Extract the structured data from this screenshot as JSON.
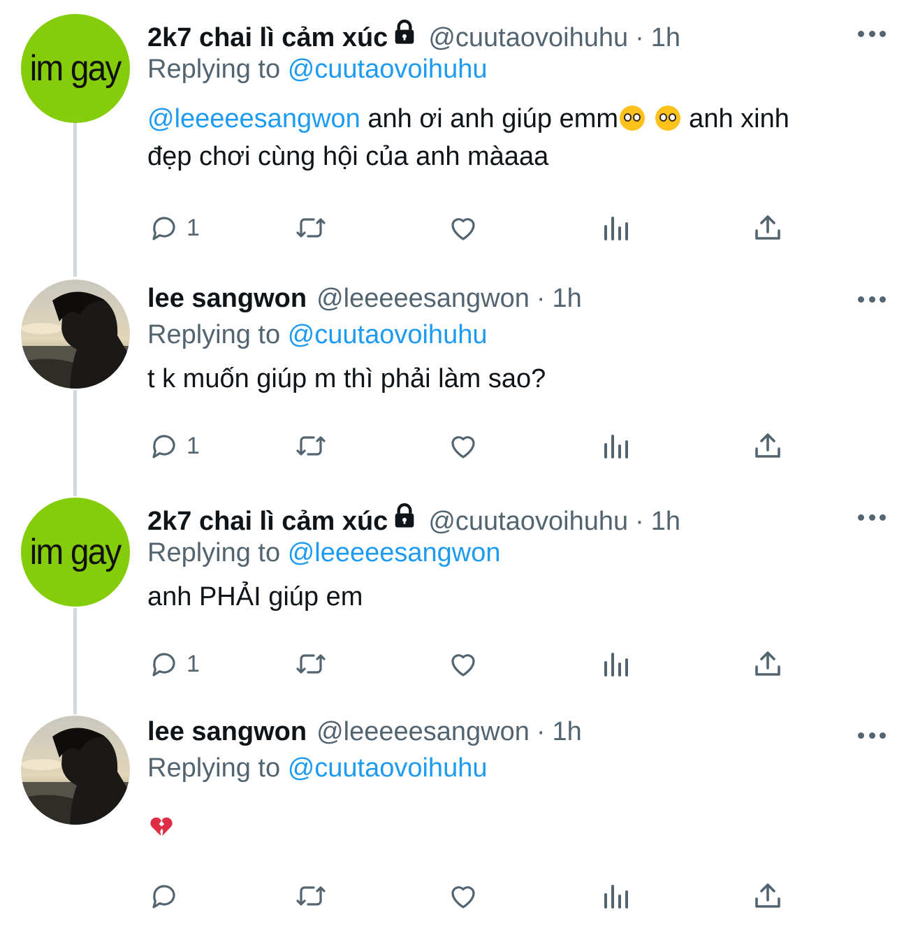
{
  "tweets": [
    {
      "avatar": "im-gay-avatar",
      "avatar_text": "im gay",
      "name": "2k7 chai lì cảm xúc",
      "locked": true,
      "handle": "@cuutaovoihuhu",
      "time": "1h",
      "replying_prefix": "Replying to",
      "replying_to": "@cuutaovoihuhu",
      "text_mention": "@leeeeesangwon",
      "text_part1": " anh ơi anh giúp emm",
      "text_part2": "  anh xinh đẹp chơi cùng hội của anh màaaa",
      "reply_count": "1"
    },
    {
      "avatar": "photo-avatar",
      "name": "lee sangwon",
      "locked": false,
      "handle": "@leeeeesangwon",
      "time": "1h",
      "replying_prefix": "Replying to",
      "replying_to": "@cuutaovoihuhu",
      "text": "t k muốn giúp m thì phải làm sao?",
      "reply_count": "1"
    },
    {
      "avatar": "im-gay-avatar",
      "avatar_text": "im gay",
      "name": "2k7 chai lì cảm xúc",
      "locked": true,
      "handle": "@cuutaovoihuhu",
      "time": "1h",
      "replying_prefix": "Replying to",
      "replying_to": "@leeeeesangwon",
      "text": "anh PHẢI giúp em",
      "reply_count": "1"
    },
    {
      "avatar": "photo-avatar",
      "name": "lee sangwon",
      "locked": false,
      "handle": "@leeeeesangwon",
      "time": "1h",
      "replying_prefix": "Replying to",
      "replying_to": "@cuutaovoihuhu",
      "text_emoji": "broken-heart",
      "reply_count": ""
    }
  ],
  "separator": "·",
  "icons": [
    "reply-icon",
    "retweet-icon",
    "like-icon",
    "views-icon",
    "share-icon",
    "more-icon",
    "lock-icon"
  ],
  "colors": {
    "link": "#1d9bf0",
    "secondary": "#536471",
    "thread_line": "#cfd9de",
    "avatar_green": "#85cc0a"
  }
}
